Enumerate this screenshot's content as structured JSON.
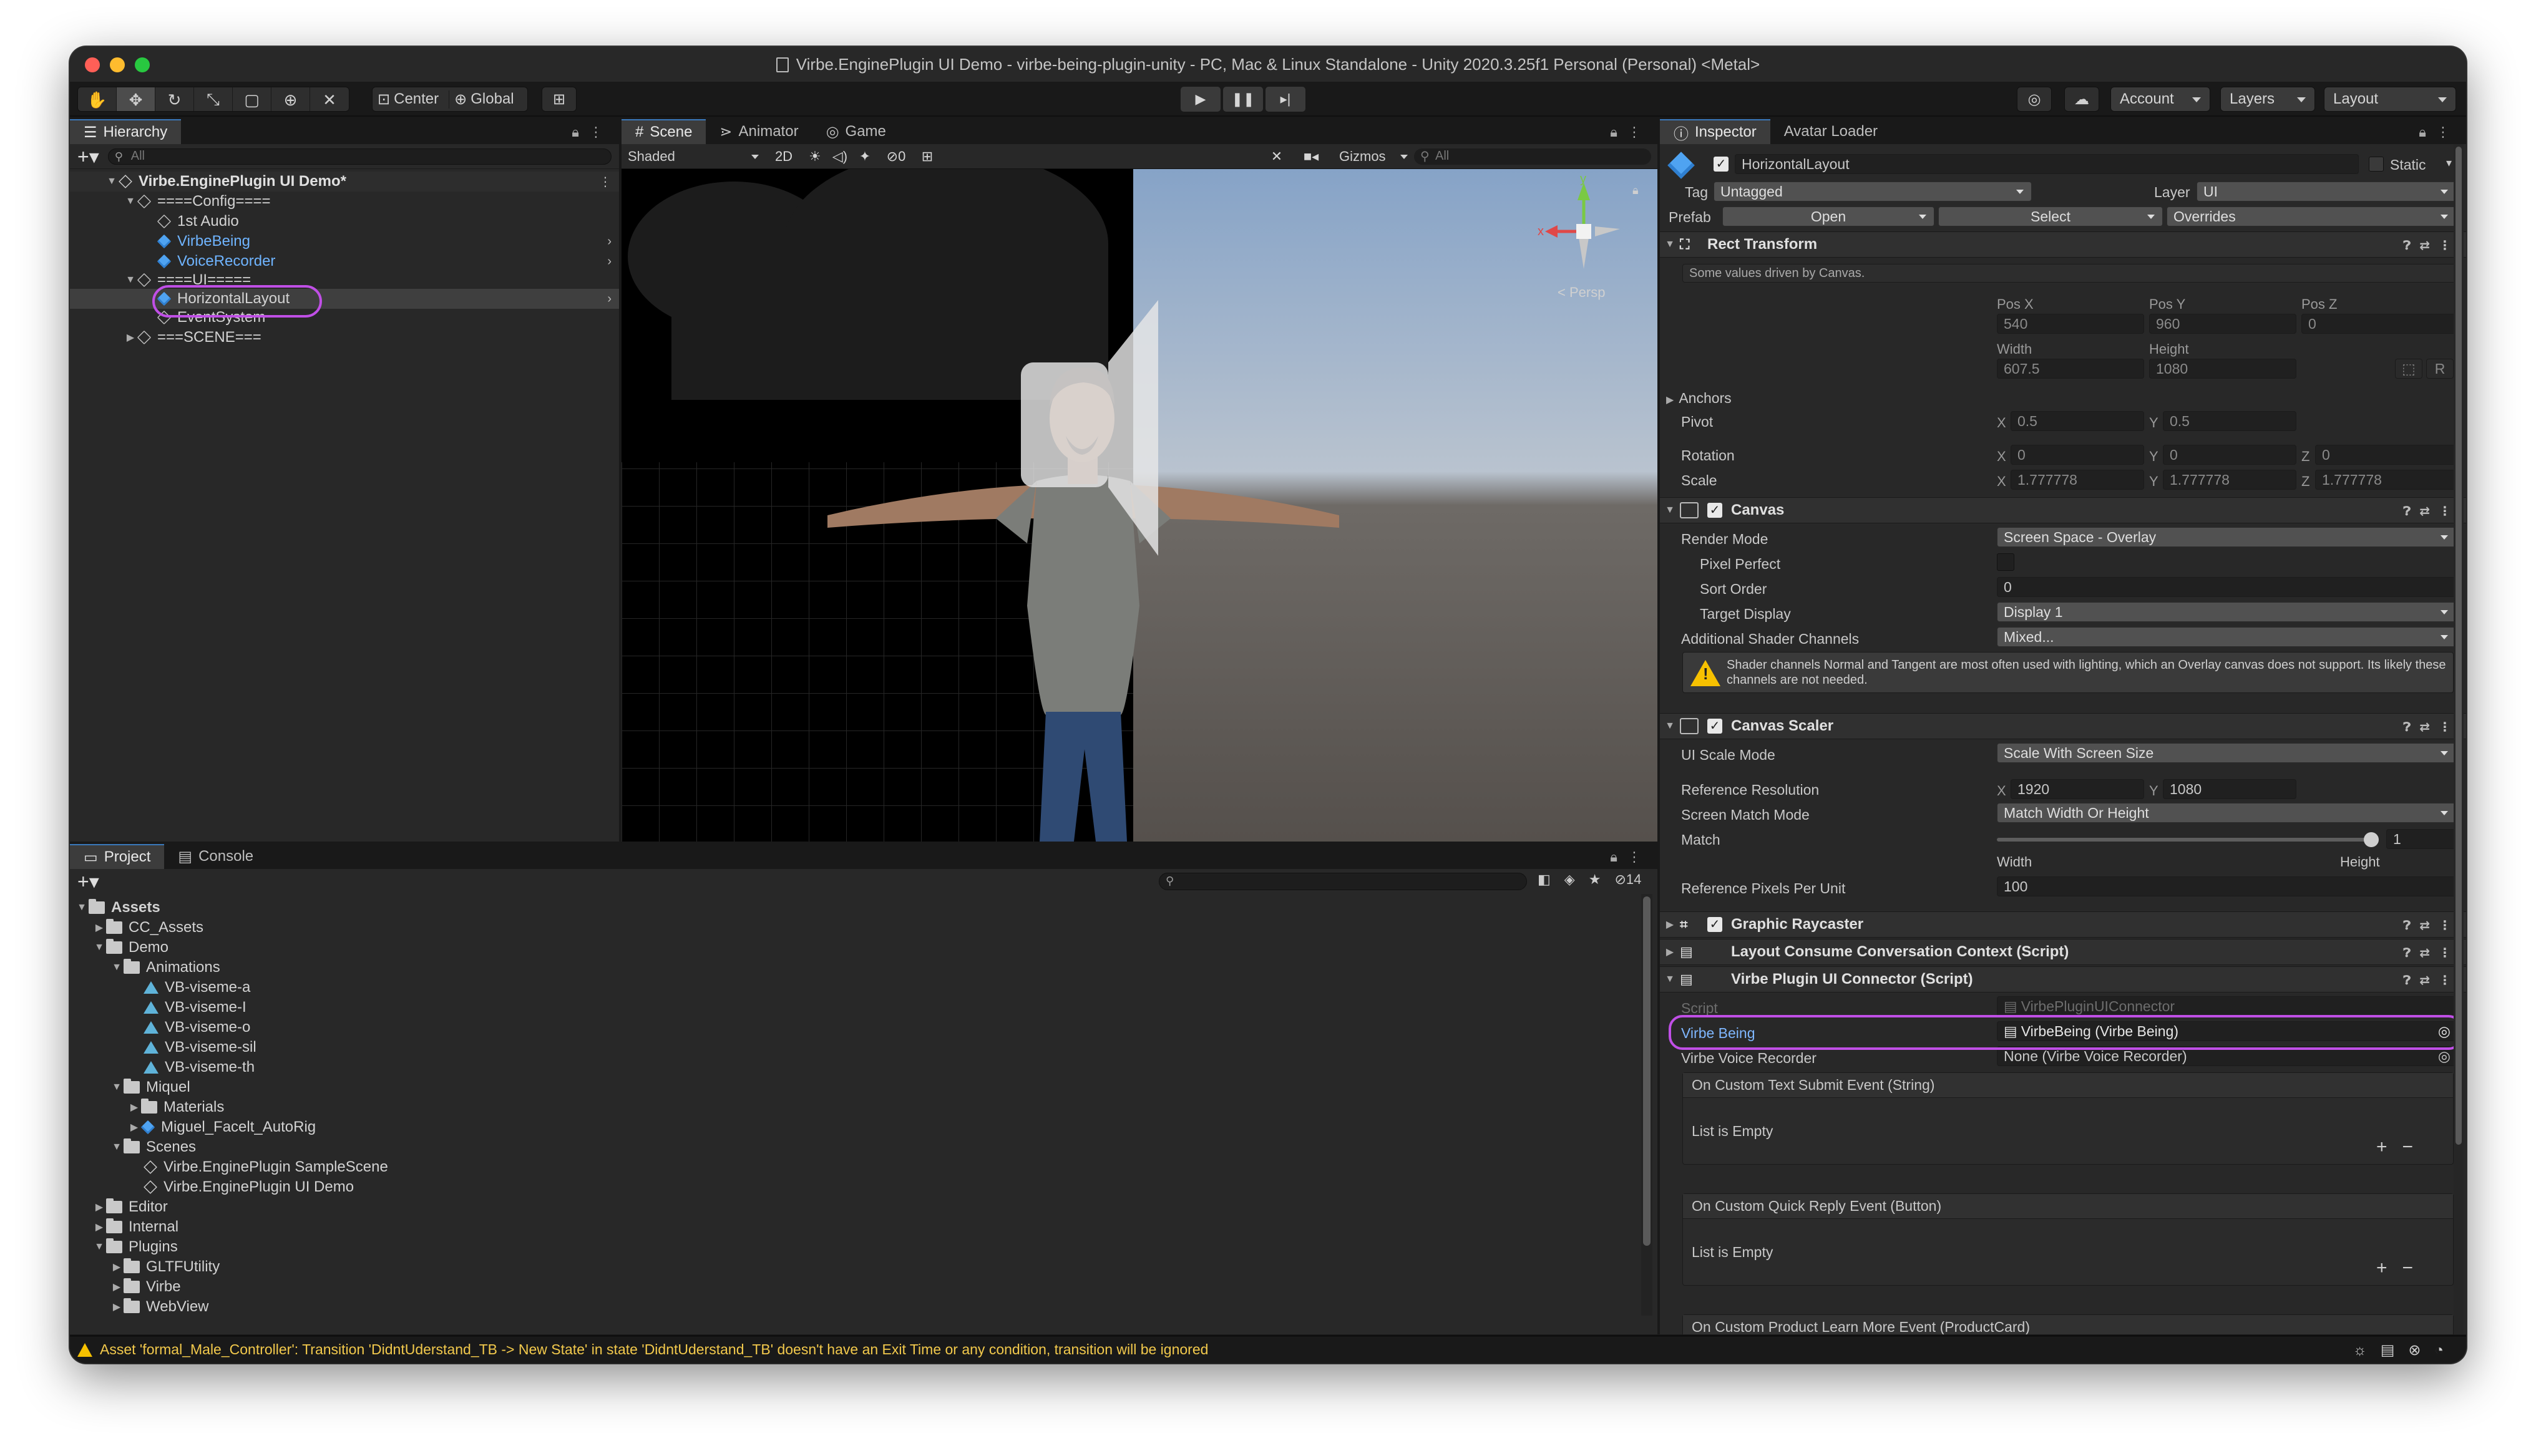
{
  "window": {
    "title": "Virbe.EnginePlugin UI Demo - virbe-being-plugin-unity - PC, Mac & Linux Standalone - Unity 2020.3.25f1 Personal (Personal) <Metal>"
  },
  "toolbar": {
    "pivot_center": "Center",
    "pivot_global": "Global",
    "account": "Account",
    "layers": "Layers",
    "layout": "Layout"
  },
  "hierarchy": {
    "tab": "Hierarchy",
    "search_placeholder": "All",
    "scene_name": "Virbe.EnginePlugin UI Demo*",
    "items": [
      {
        "label": "====Config===="
      },
      {
        "label": "1st Audio"
      },
      {
        "label": "VirbeBeing"
      },
      {
        "label": "VoiceRecorder"
      },
      {
        "label": "====UI====="
      },
      {
        "label": "HorizontalLayout"
      },
      {
        "label": "EventSystem"
      },
      {
        "label": "===SCENE==="
      }
    ]
  },
  "scene_view": {
    "tabs": [
      {
        "label": "Scene"
      },
      {
        "label": "Animator"
      },
      {
        "label": "Game"
      }
    ],
    "shading": "Shaded",
    "mode_2d": "2D",
    "hidden_count": "0",
    "gizmos": "Gizmos",
    "search_placeholder": "All",
    "persp_label": "< Persp",
    "axis_x": "x",
    "axis_y": "y"
  },
  "project": {
    "tabs": [
      {
        "label": "Project"
      },
      {
        "label": "Console"
      }
    ],
    "hidden_count": "14",
    "items": [
      {
        "label": "Assets"
      },
      {
        "label": "CC_Assets"
      },
      {
        "label": "Demo"
      },
      {
        "label": "Animations"
      },
      {
        "label": "VB-viseme-a"
      },
      {
        "label": "VB-viseme-I"
      },
      {
        "label": "VB-viseme-o"
      },
      {
        "label": "VB-viseme-sil"
      },
      {
        "label": "VB-viseme-th"
      },
      {
        "label": "Miquel"
      },
      {
        "label": "Materials"
      },
      {
        "label": "Miguel_Facelt_AutoRig"
      },
      {
        "label": "Scenes"
      },
      {
        "label": "Virbe.EnginePlugin SampleScene"
      },
      {
        "label": "Virbe.EnginePlugin UI Demo"
      },
      {
        "label": "Editor"
      },
      {
        "label": "Internal"
      },
      {
        "label": "Plugins"
      },
      {
        "label": "GLTFUtility"
      },
      {
        "label": "Virbe"
      },
      {
        "label": "WebView"
      }
    ]
  },
  "inspector": {
    "tabs": [
      {
        "label": "Inspector"
      },
      {
        "label": "Avatar Loader"
      }
    ],
    "object_name": "HorizontalLayout",
    "static_label": "Static",
    "tag_label": "Tag",
    "tag_value": "Untagged",
    "layer_label": "Layer",
    "layer_value": "UI",
    "prefab_label": "Prefab",
    "prefab_open": "Open",
    "prefab_select": "Select",
    "prefab_overrides": "Overrides",
    "rect_transform": {
      "title": "Rect Transform",
      "note": "Some values driven by Canvas.",
      "pos_x_label": "Pos X",
      "pos_x": "540",
      "pos_y_label": "Pos Y",
      "pos_y": "960",
      "pos_z_label": "Pos Z",
      "pos_z": "0",
      "width_label": "Width",
      "width": "607.5",
      "height_label": "Height",
      "height": "1080",
      "r_button": "R",
      "anchors": "Anchors",
      "pivot": "Pivot",
      "pivot_x": "0.5",
      "pivot_y": "0.5",
      "rotation": "Rotation",
      "rot_x": "0",
      "rot_y": "0",
      "rot_z": "0",
      "scale": "Scale",
      "scale_x": "1.777778",
      "scale_y": "1.777778",
      "scale_z": "1.777778"
    },
    "canvas": {
      "title": "Canvas",
      "render_mode_label": "Render Mode",
      "render_mode": "Screen Space - Overlay",
      "pixel_perfect_label": "Pixel Perfect",
      "sort_order_label": "Sort Order",
      "sort_order": "0",
      "target_display_label": "Target Display",
      "target_display": "Display 1",
      "shader_channels_label": "Additional Shader Channels",
      "shader_channels": "Mixed...",
      "warning": "Shader channels Normal and Tangent are most often used with lighting, which an Overlay canvas does not support. Its likely these channels are not needed."
    },
    "canvas_scaler": {
      "title": "Canvas Scaler",
      "ui_scale_mode_label": "UI Scale Mode",
      "ui_scale_mode": "Scale With Screen Size",
      "ref_res_label": "Reference Resolution",
      "ref_x": "1920",
      "ref_y": "1080",
      "match_mode_label": "Screen Match Mode",
      "match_mode": "Match Width Or Height",
      "match_label": "Match",
      "match_value": "1",
      "match_fraction": 1,
      "match_left": "Width",
      "match_right": "Height",
      "ref_ppu_label": "Reference Pixels Per Unit",
      "ref_ppu": "100"
    },
    "graphic_raycaster": {
      "title": "Graphic Raycaster"
    },
    "layout_consume": {
      "title": "Layout Consume Conversation Context (Script)"
    },
    "ui_connector": {
      "title": "Virbe Plugin UI Connector (Script)",
      "script_label": "Script",
      "script_value": "VirbePluginUIConnector",
      "being_label": "Virbe Being",
      "being_value": "VirbeBeing (Virbe Being)",
      "voice_label": "Virbe Voice Recorder",
      "voice_value": "None (Virbe Voice Recorder)",
      "event1": "On Custom Text Submit Event (String)",
      "event2": "On Custom Quick Reply Event (Button)",
      "event3": "On Custom Product Learn More Event (ProductCard)",
      "empty": "List is Empty"
    }
  },
  "status_bar": {
    "message": "Asset 'formal_Male_Controller': Transition 'DidntUderstand_TB -> New State' in state 'DidntUderstand_TB' doesn't have an Exit Time or any condition, transition will be ignored"
  },
  "colors": {
    "highlight": "#c04fe6",
    "selection_blue": "#6fb4ff",
    "warning": "#f7c100"
  }
}
